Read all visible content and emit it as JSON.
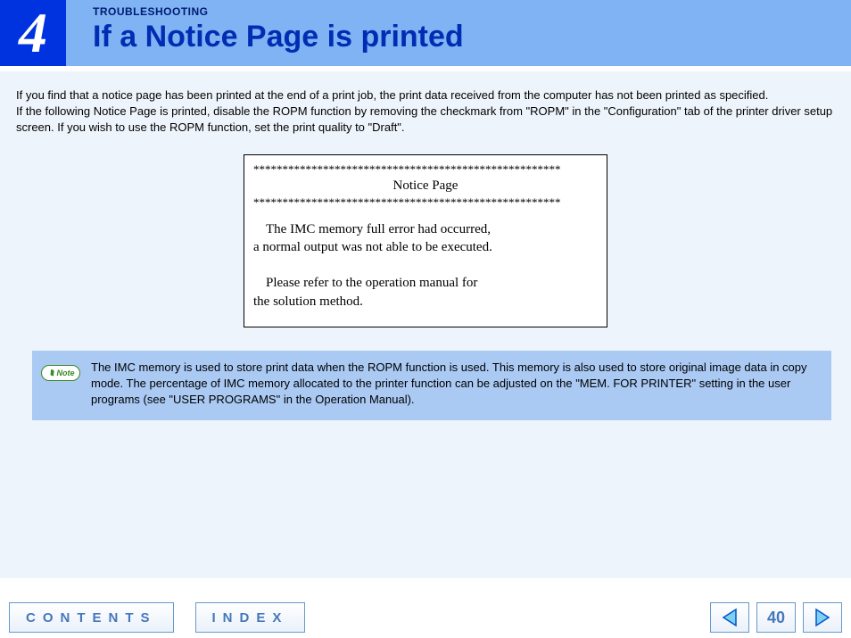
{
  "header": {
    "chapter_number": "4",
    "section_label": "TROUBLESHOOTING",
    "page_title": "If a Notice Page is printed"
  },
  "intro": {
    "p1": "If you find that a notice page has been printed at the end of a print job, the print data received from the computer has not been printed as specified.",
    "p2": "If the following Notice Page is printed, disable the ROPM function by removing the checkmark from \"ROPM\" in the \"Configuration\" tab of the printer driver setup screen. If you wish to use the ROPM function, set the print quality to \"Draft\"."
  },
  "notice_box": {
    "asterisks": "*****************************************************",
    "title": "Notice Page",
    "line1": "The IMC memory full error had occurred,",
    "line2": "a normal output was not able to be executed.",
    "line3": "Please refer to the operation manual for",
    "line4": "the solution method."
  },
  "note": {
    "badge": "Note",
    "text": "The IMC memory is used to store print data when the ROPM function is used. This memory is also used to store original image data in copy mode. The percentage of IMC memory allocated to the printer function can be adjusted on the \"MEM. FOR PRINTER\" setting in the user programs (see \"USER PROGRAMS\" in the Operation Manual)."
  },
  "footer": {
    "contents": "CONTENTS",
    "index": "INDEX",
    "page_number": "40"
  },
  "icons": {
    "prev": "prev-arrow-icon",
    "next": "next-arrow-icon"
  }
}
